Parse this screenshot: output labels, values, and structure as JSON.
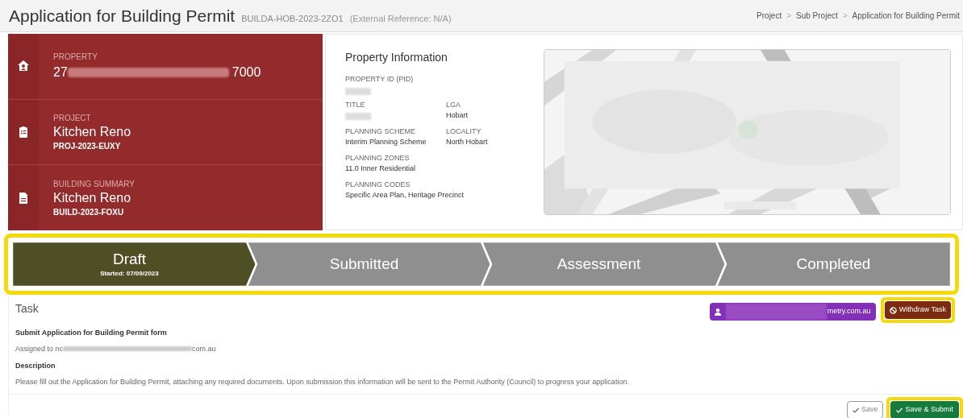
{
  "header": {
    "title": "Application for Building Permit",
    "reference": "BUILDA-HOB-2023-2ZO1",
    "external_reference": "(External Reference: N/A)",
    "breadcrumbs": [
      "Project",
      "Sub Project",
      "Application for Building Permit"
    ],
    "separator": ">"
  },
  "summary": [
    {
      "kind": "property",
      "label": "PROPERTY",
      "value_start": "27",
      "value_end": "7000"
    },
    {
      "kind": "project",
      "label": "PROJECT",
      "value": "Kitchen Reno",
      "code": "PROJ-2023-EUXY"
    },
    {
      "kind": "building",
      "label": "BUILDING SUMMARY",
      "value": "Kitchen Reno",
      "code": "BUILD-2023-FOXU"
    }
  ],
  "property_info": {
    "title": "Property Information",
    "fields": [
      {
        "label": "PROPERTY ID (PID)",
        "redacted": true
      },
      {
        "label": "TITLE",
        "redacted": true
      },
      {
        "label": "LGA",
        "value": "Hobart"
      },
      {
        "label": "PLANNING SCHEME",
        "value": "Interim Planning Scheme"
      },
      {
        "label": "LOCALITY",
        "value": "North Hobart"
      },
      {
        "label": "PLANNING ZONES",
        "value": "11.0 Inner Residential"
      },
      {
        "label": "PLANNING CODES",
        "value": "Specific Area Plan, Heritage Precinct"
      }
    ]
  },
  "stages": [
    {
      "label": "Draft",
      "sub": "Started: 07/09/2023",
      "selected": true
    },
    {
      "label": "Submitted",
      "selected": false
    },
    {
      "label": "Assessment",
      "selected": false
    },
    {
      "label": "Completed",
      "selected": false
    }
  ],
  "task": {
    "heading": "Task",
    "assignee_chip": {
      "end": "metry.com.au"
    },
    "withdraw_button": "Withdraw Task",
    "title": "Submit Application for Building Permit form",
    "assigned_start": "Assigned to nc",
    "assigned_end": "com.au",
    "description_heading": "Description",
    "description": "Please fill out the Application for Building Permit, attaching any required documents. Upon submission this information will be sent to the Permit Authority (Council) to progress your application.",
    "save_button": "Save",
    "submit_button": "Save & Submit"
  }
}
